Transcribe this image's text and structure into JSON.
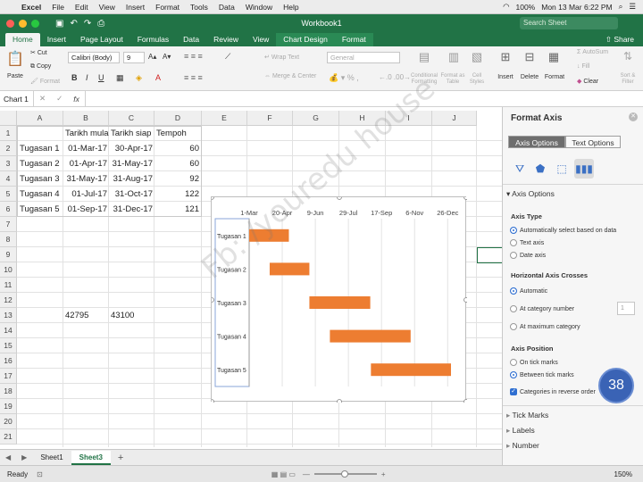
{
  "macbar": {
    "menu": [
      "Excel",
      "File",
      "Edit",
      "View",
      "Insert",
      "Format",
      "Tools",
      "Data",
      "Window",
      "Help"
    ],
    "battery": "100%",
    "datetime": "Mon 13 Mar  6:22 PM"
  },
  "titlebar": {
    "title": "Workbook1",
    "search_placeholder": "Search Sheet"
  },
  "ribbon_tabs": [
    "Home",
    "Insert",
    "Page Layout",
    "Formulas",
    "Data",
    "Review",
    "View",
    "Chart Design",
    "Format"
  ],
  "share_label": "Share",
  "ribbon": {
    "paste": "Paste",
    "cut": "Cut",
    "copy": "Copy",
    "format": "Format",
    "font_name": "Calibri (Body)",
    "font_size": "9",
    "wrap_text": "Wrap Text",
    "merge_center": "Merge & Center",
    "number_format": "General",
    "conditional_formatting": "Conditional Formatting",
    "format_as_table": "Format as Table",
    "cell_styles": "Cell Styles",
    "insert": "Insert",
    "delete": "Delete",
    "format_cells": "Format",
    "autosum": "AutoSum",
    "fill": "Fill",
    "clear": "Clear",
    "sort_filter": "Sort & Filter"
  },
  "formula_bar": {
    "name_box": "Chart 1",
    "fx": "fx"
  },
  "grid": {
    "columns": [
      "A",
      "B",
      "C",
      "D",
      "E",
      "F",
      "G",
      "H",
      "I",
      "J"
    ],
    "rows": [
      "1",
      "2",
      "3",
      "4",
      "5",
      "6",
      "7",
      "8",
      "9",
      "10",
      "11",
      "12",
      "13",
      "14",
      "15",
      "16",
      "17",
      "18",
      "19",
      "20",
      "21"
    ],
    "header": [
      "",
      "Tarikh mula",
      "Tarikh siap",
      "Tempoh"
    ],
    "data": [
      [
        "Tugasan 1",
        "01-Mar-17",
        "30-Apr-17",
        "60"
      ],
      [
        "Tugasan 2",
        "01-Apr-17",
        "31-May-17",
        "60"
      ],
      [
        "Tugasan 3",
        "31-May-17",
        "31-Aug-17",
        "92"
      ],
      [
        "Tugasan 4",
        "01-Jul-17",
        "31-Oct-17",
        "122"
      ],
      [
        "Tugasan 5",
        "01-Sep-17",
        "31-Dec-17",
        "121"
      ]
    ],
    "row13": [
      "42795",
      "43100"
    ]
  },
  "chart_data": {
    "type": "bar",
    "orientation": "horizontal",
    "stacked": true,
    "categories": [
      "Tugasan 1",
      "Tugasan 2",
      "Tugasan 3",
      "Tugasan 4",
      "Tugasan 5"
    ],
    "series": [
      {
        "values": [
          "2017-03-01",
          "2017-04-01",
          "2017-05-31",
          "2017-07-01",
          "2017-09-01"
        ],
        "color": "none"
      },
      {
        "values": [
          60,
          60,
          92,
          122,
          121
        ],
        "color": "#ed7d31"
      }
    ],
    "x_ticks": [
      "1-Mar",
      "20-Apr",
      "9-Jun",
      "29-Jul",
      "17-Sep",
      "6-Nov",
      "26-Dec"
    ],
    "xlim": [
      "2017-03-01",
      "2017-12-31"
    ],
    "y_reverse": true,
    "grid": true,
    "title": ""
  },
  "sheets": [
    "Sheet1",
    "Sheet3"
  ],
  "status": {
    "ready": "Ready",
    "zoom": "150%"
  },
  "panel": {
    "title": "Format Axis",
    "tab_axis": "Axis Options",
    "tab_text": "Text Options",
    "section_axis_options": "Axis Options",
    "axis_type_label": "Axis Type",
    "axis_type_options": [
      "Automatically select based on data",
      "Text axis",
      "Date axis"
    ],
    "crosses_label": "Horizontal Axis Crosses",
    "crosses_options": [
      "Automatic",
      "At category number",
      "At maximum category"
    ],
    "crosses_value": "1",
    "position_label": "Axis Position",
    "position_options": [
      "On tick marks",
      "Between tick marks"
    ],
    "reverse_label": "Categories in reverse order",
    "sections": [
      "Tick Marks",
      "Labels",
      "Number"
    ]
  },
  "badge": "38",
  "watermark": "Fb: /youredu house"
}
